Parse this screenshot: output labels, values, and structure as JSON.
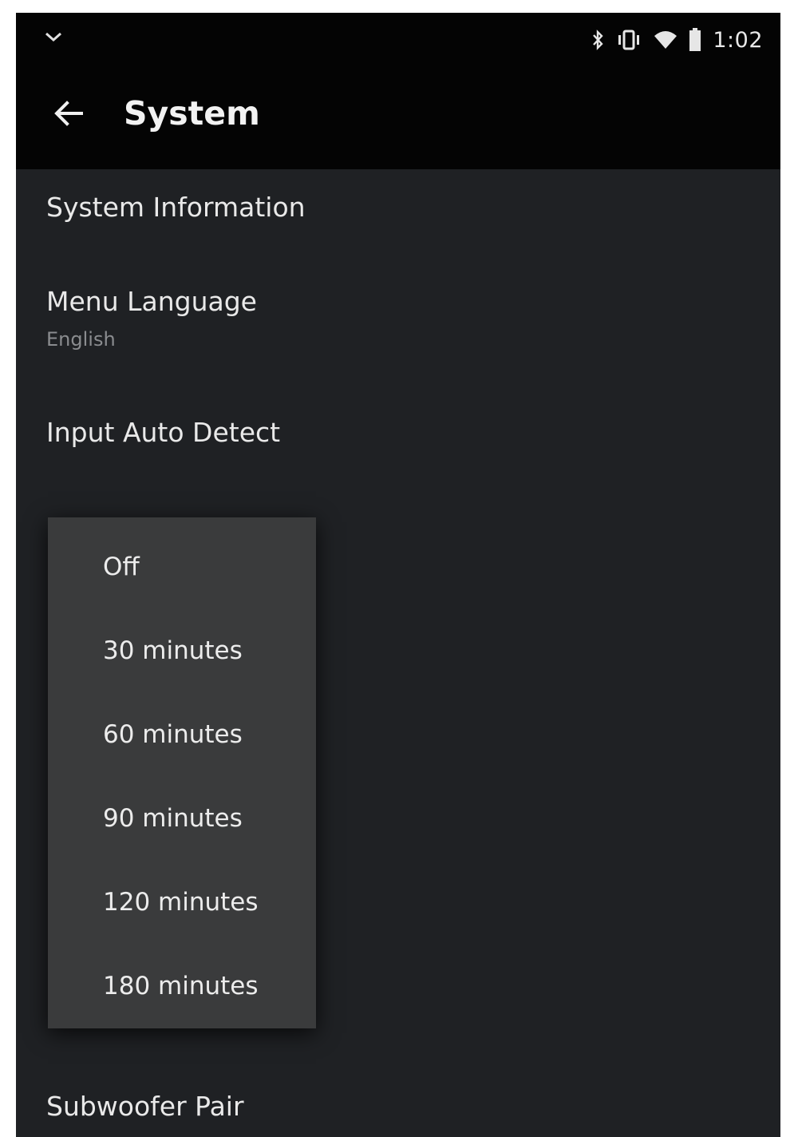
{
  "status_bar": {
    "time": "1:02",
    "icons": [
      "wifi-notification-icon",
      "bluetooth-icon",
      "vibrate-icon",
      "wifi-signal-icon",
      "battery-icon"
    ]
  },
  "app_bar": {
    "title": "System",
    "back_icon": "arrow-left-icon"
  },
  "settings": {
    "items": [
      {
        "label": "System Information"
      },
      {
        "label": "Menu Language",
        "value": "English"
      },
      {
        "label": "Input Auto Detect"
      },
      {
        "label": "Subwoofer Pair"
      }
    ]
  },
  "sleep_dropdown": {
    "options": [
      "Off",
      "30 minutes",
      "60 minutes",
      "90 minutes",
      "120 minutes",
      "180 minutes"
    ]
  },
  "colors": {
    "background": "#1f2124",
    "app_bar": "#040404",
    "dropdown": "#3a3b3c",
    "text_primary": "#e9e9e9",
    "text_secondary": "#8a8c8f"
  }
}
